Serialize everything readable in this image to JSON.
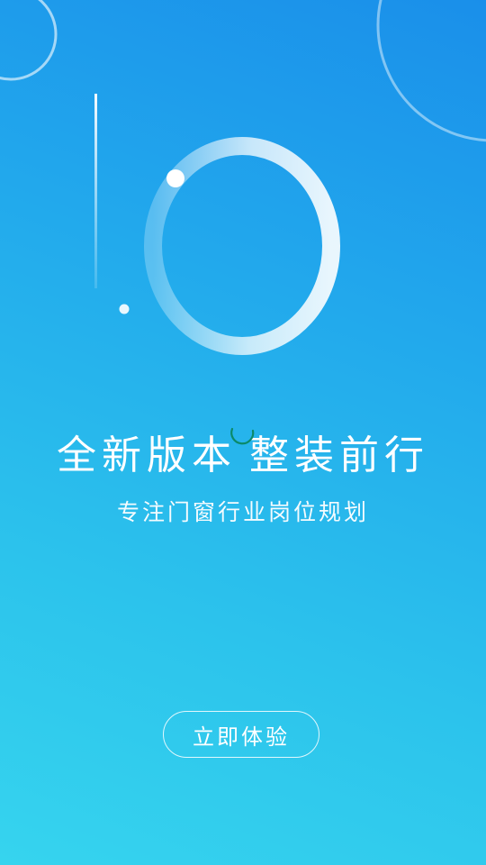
{
  "splash": {
    "headline_part1": "全新版本",
    "headline_part2": "整装前行",
    "subtitle": "专注门窗行业岗位规划",
    "cta_label": "立即体验"
  },
  "colors": {
    "gradient_top": "#1a8fea",
    "gradient_bottom": "#36d4ee",
    "text": "#ffffff",
    "spinner": "#0b8a6a"
  },
  "icons": {
    "loading": "loading-spinner-icon",
    "version_logo": "version-1-0-logo"
  }
}
